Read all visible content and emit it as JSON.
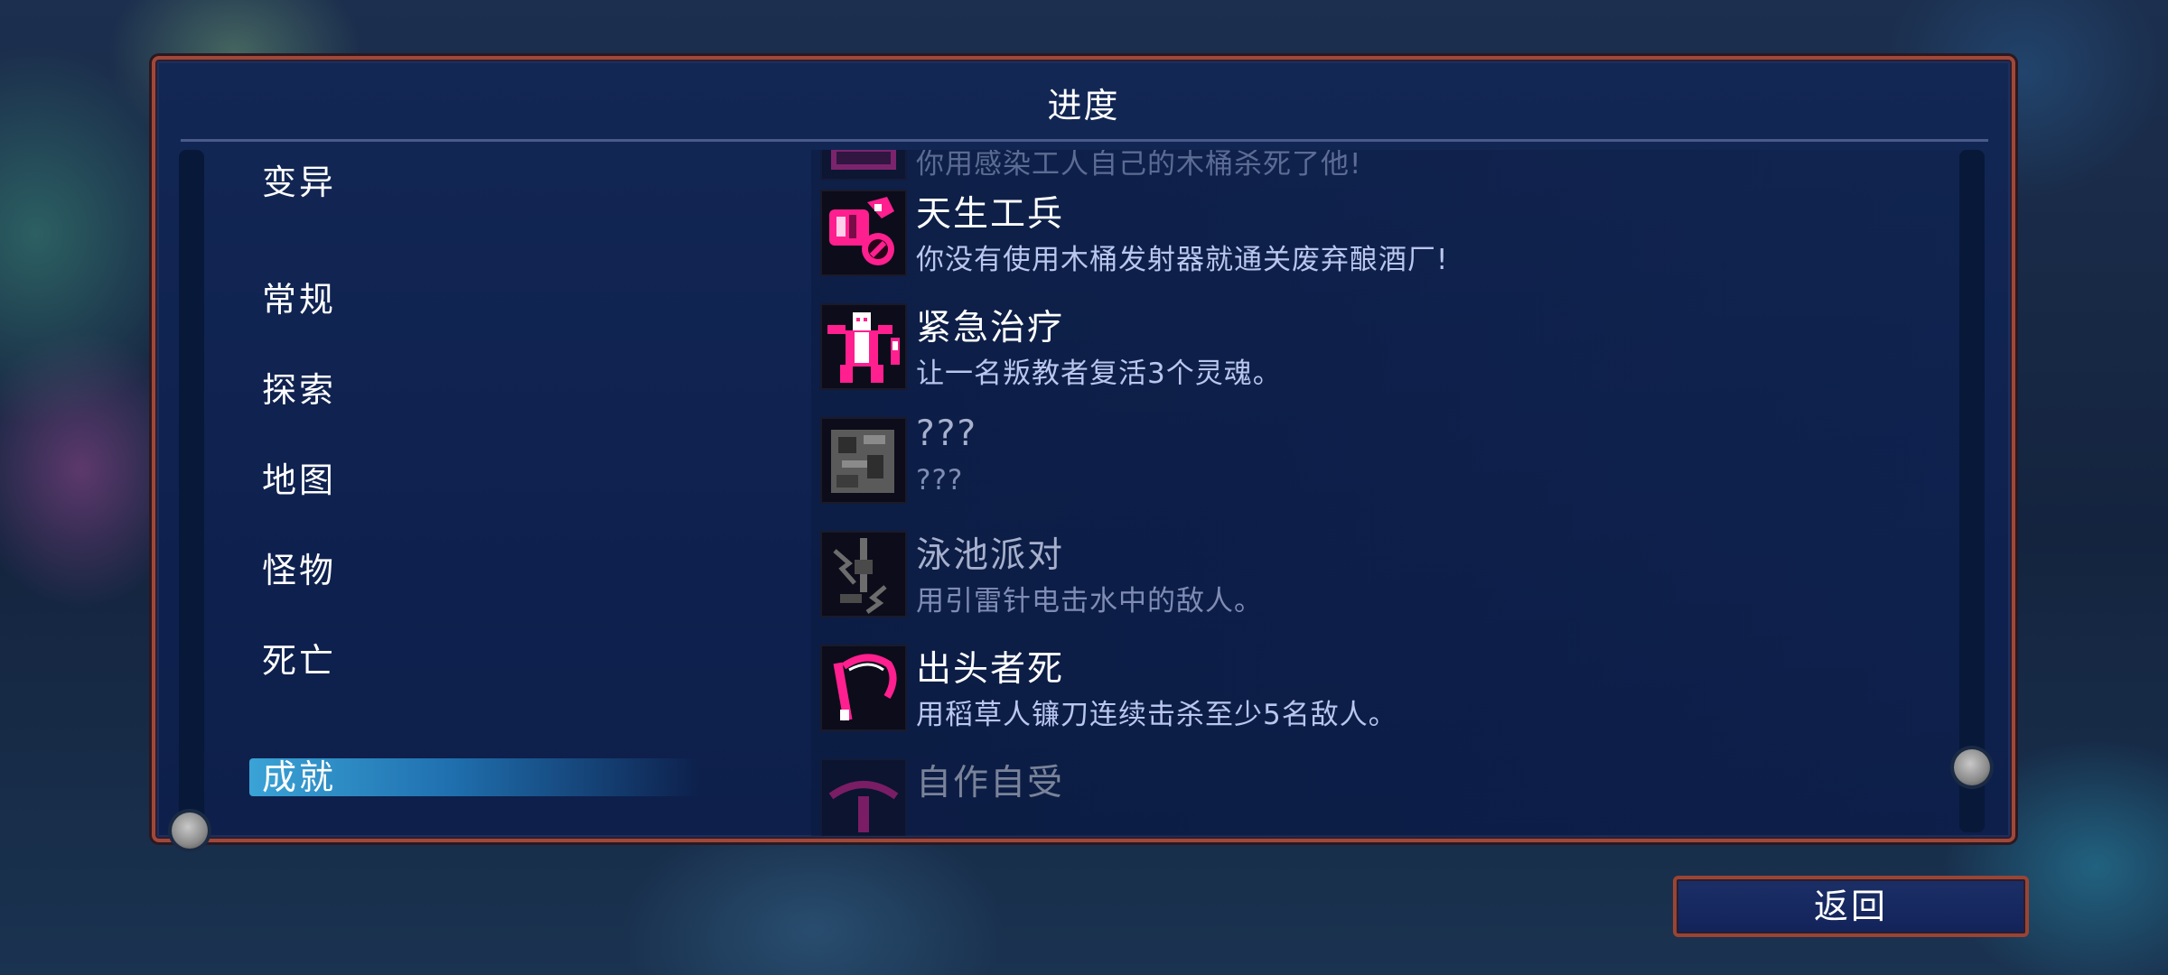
{
  "panel": {
    "title": "进度"
  },
  "categories": [
    {
      "label": "变异",
      "selected": false
    },
    {
      "label": "常规",
      "selected": false
    },
    {
      "label": "探索",
      "selected": false
    },
    {
      "label": "地图",
      "selected": false
    },
    {
      "label": "怪物",
      "selected": false
    },
    {
      "label": "死亡",
      "selected": false
    },
    {
      "label": "成就",
      "selected": true
    }
  ],
  "achievements": [
    {
      "name": "",
      "description": "你用感染工人自己的木桶杀死了他!",
      "icon": "crown-barrel-icon",
      "state": "partial"
    },
    {
      "name": "天生工兵",
      "description": "你没有使用木桶发射器就通关废弃酿酒厂!",
      "icon": "barrel-launcher-no-icon",
      "state": "unlocked"
    },
    {
      "name": "紧急治疗",
      "description": "让一名叛教者复活3个灵魂。",
      "icon": "apostate-icon",
      "state": "unlocked"
    },
    {
      "name": "???",
      "description": "???",
      "icon": "mystery-scroll-icon",
      "state": "hidden"
    },
    {
      "name": "泳池派对",
      "description": "用引雷针电击水中的敌人。",
      "icon": "lightning-rod-icon",
      "state": "locked"
    },
    {
      "name": "出头者死",
      "description": "用稻草人镰刀连续击杀至少5名敌人。",
      "icon": "scythe-icon",
      "state": "unlocked"
    },
    {
      "name": "自作自受",
      "description": "",
      "icon": "self-harm-icon",
      "state": "partial"
    }
  ],
  "footer": {
    "back_label": "返回"
  },
  "colors": {
    "accent_magenta": "#ff1f8f",
    "border": "#a04838",
    "selected_tab": "#3aa3d6"
  }
}
